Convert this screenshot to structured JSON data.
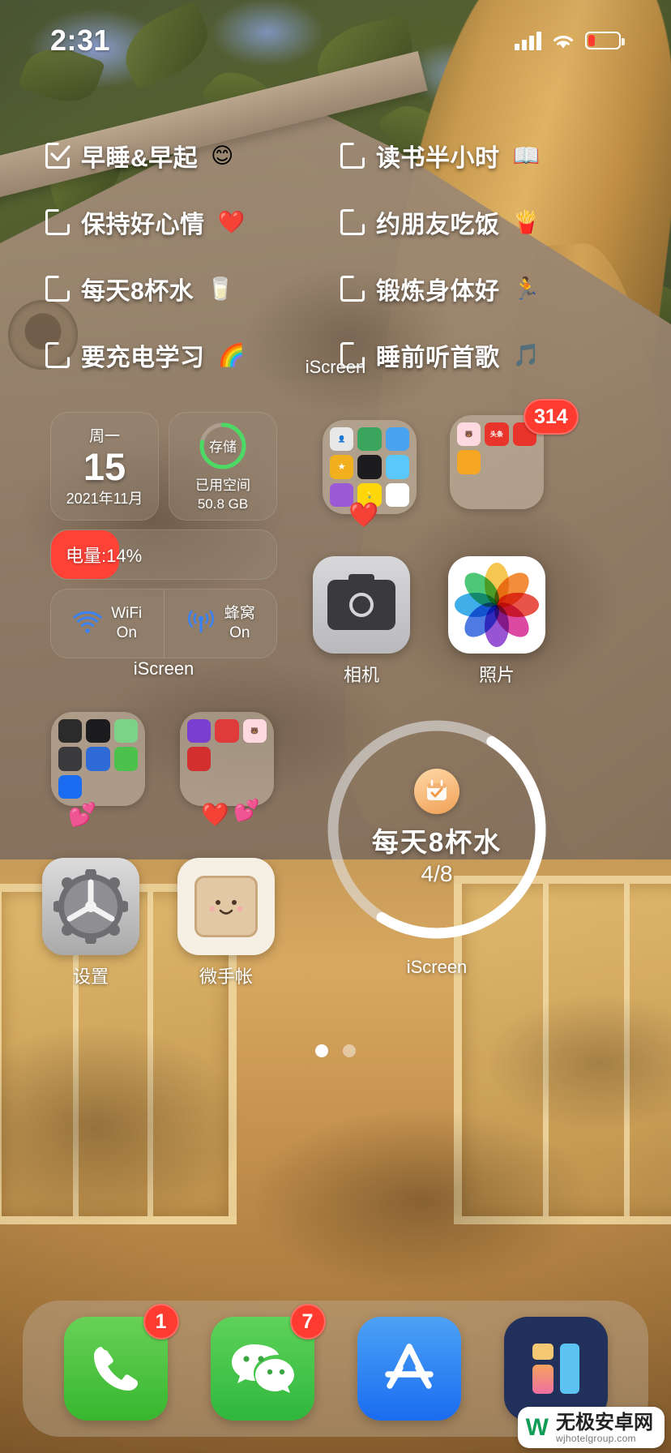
{
  "status_bar": {
    "time": "2:31",
    "signal_icon": "cellular-bars-icon",
    "wifi_icon": "wifi-icon",
    "battery_icon": "battery-low-icon",
    "battery_fill_percent": 14,
    "battery_color": "#ff3b30"
  },
  "checklist_widget": {
    "caption": "iScreen",
    "items": [
      {
        "checked": true,
        "label": "早睡&早起",
        "emoji": "😊"
      },
      {
        "checked": false,
        "label": "读书半小时",
        "emoji": "📖"
      },
      {
        "checked": false,
        "label": "保持好心情",
        "emoji": "❤️"
      },
      {
        "checked": false,
        "label": "约朋友吃饭",
        "emoji": "🍟"
      },
      {
        "checked": false,
        "label": "每天8杯水",
        "emoji": "🥛"
      },
      {
        "checked": false,
        "label": "锻炼身体好",
        "emoji": "🏃"
      },
      {
        "checked": false,
        "label": "要充电学习",
        "emoji": "🌈"
      },
      {
        "checked": false,
        "label": "睡前听首歌",
        "emoji": "🎵"
      }
    ]
  },
  "info_widget": {
    "caption": "iScreen",
    "date": {
      "weekday": "周一",
      "day": "15",
      "year_month": "2021年11月"
    },
    "storage": {
      "ring_label": "存储",
      "sub_label": "已用空间",
      "value": "50.8 GB",
      "ring_color": "#4cd964",
      "used_percent": 78
    },
    "battery": {
      "text": "电量:14%",
      "percent": 14,
      "color": "#ff4136"
    },
    "connectivity": [
      {
        "icon": "wifi-icon",
        "label": "WiFi",
        "state": "On",
        "color": "#3b82f6"
      },
      {
        "icon": "cellular-icon",
        "label": "蜂窝",
        "state": "On",
        "color": "#3b82f6"
      }
    ]
  },
  "folders": [
    {
      "name": "apps-folder-one",
      "apps": [
        {
          "name": "contacts",
          "color": "#e8e8e8",
          "glyph": "👤"
        },
        {
          "name": "browser",
          "color": "#3ba55d",
          "glyph": ""
        },
        {
          "name": "files",
          "color": "#4aa3f0",
          "glyph": ""
        },
        {
          "name": "ratings",
          "color": "#f2b01e",
          "glyph": "★"
        },
        {
          "name": "music-circle",
          "color": "#1c1c1e",
          "glyph": ""
        },
        {
          "name": "photos-app",
          "color": "#5ac8fa",
          "glyph": ""
        },
        {
          "name": "podcasts",
          "color": "#9b59d6",
          "glyph": ""
        },
        {
          "name": "tips",
          "color": "#ffd60a",
          "glyph": "💡"
        },
        {
          "name": "wallet",
          "color": "#ffffff",
          "glyph": ""
        }
      ]
    },
    {
      "name": "social-folder",
      "badge": "314",
      "apps": [
        {
          "name": "xiaohongshu",
          "color": "#ffd9e0",
          "glyph": "🐻"
        },
        {
          "name": "toutiao",
          "color": "#e8342a",
          "glyph": "头条"
        },
        {
          "name": "news-extra",
          "color": "#e8342a",
          "glyph": ""
        },
        {
          "name": "weibo",
          "color": "#f5a623",
          "glyph": ""
        }
      ]
    },
    {
      "name": "utilities-folder",
      "apps": [
        {
          "name": "calculator",
          "color": "#2b2b2b",
          "glyph": ""
        },
        {
          "name": "clock",
          "color": "#1c1c1e",
          "glyph": ""
        },
        {
          "name": "maps",
          "color": "#7bd389",
          "glyph": ""
        },
        {
          "name": "keypad",
          "color": "#3a3a3c",
          "glyph": ""
        },
        {
          "name": "shortcuts",
          "color": "#2f6bd6",
          "glyph": ""
        },
        {
          "name": "notes-green",
          "color": "#4cc14c",
          "glyph": ""
        },
        {
          "name": "appstore-small",
          "color": "#1a6cf0",
          "glyph": ""
        }
      ]
    },
    {
      "name": "entertainment-folder",
      "apps": [
        {
          "name": "video-purple",
          "color": "#7a3fd0",
          "glyph": ""
        },
        {
          "name": "music-red",
          "color": "#e03a3a",
          "glyph": ""
        },
        {
          "name": "bear-app",
          "color": "#ffd9e0",
          "glyph": "🐻"
        },
        {
          "name": "novel-red",
          "color": "#d32f2f",
          "glyph": ""
        }
      ]
    }
  ],
  "apps": [
    {
      "name": "camera",
      "label": "相机",
      "icon": "camera-icon"
    },
    {
      "name": "photos",
      "label": "照片",
      "icon": "photos-flower-icon"
    },
    {
      "name": "settings",
      "label": "设置",
      "icon": "gear-icon"
    },
    {
      "name": "weishouzhang",
      "label": "微手帐",
      "icon": "notebook-icon"
    }
  ],
  "water_widget": {
    "title": "每天8杯水",
    "count": "4/8",
    "progress_percent": 50,
    "caption": "iScreen",
    "badge_icon": "calendar-check-icon",
    "ring_color": "#ffffff",
    "track_color": "rgba(230,230,230,0.65)"
  },
  "decorations": [
    {
      "name": "heart-emoji",
      "emoji": "❤️"
    },
    {
      "name": "hearts-emoji",
      "emoji": "💕"
    },
    {
      "name": "hearts-emoji-2",
      "emoji": "💕"
    },
    {
      "name": "heart-emoji-2",
      "emoji": "❤️"
    }
  ],
  "page_dots": {
    "total": 2,
    "active_index": 0
  },
  "dock": {
    "apps": [
      {
        "name": "phone",
        "icon": "phone-icon",
        "badge": "1"
      },
      {
        "name": "wechat",
        "icon": "wechat-icon",
        "badge": "7"
      },
      {
        "name": "app-store",
        "icon": "appstore-icon",
        "badge": ""
      },
      {
        "name": "iscreen",
        "icon": "iscreen-icon",
        "badge": ""
      }
    ]
  },
  "watermark": {
    "logo": "W",
    "main": "无极安卓网",
    "sub": "wjhotelgroup.com"
  }
}
